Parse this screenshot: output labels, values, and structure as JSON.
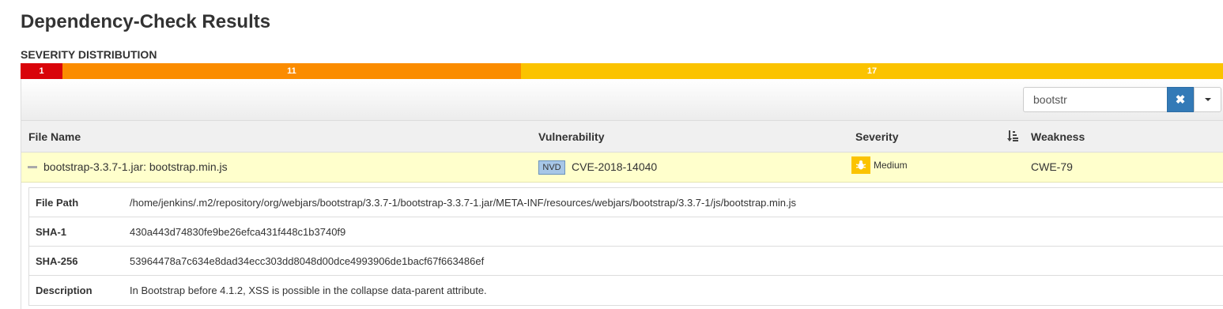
{
  "page": {
    "title": "Dependency-Check Results"
  },
  "severity_distribution": {
    "label": "SEVERITY DISTRIBUTION",
    "segments": [
      {
        "name": "critical",
        "count": "1",
        "color": "#d9040a"
      },
      {
        "name": "high",
        "count": "11",
        "color": "#fb8c00"
      },
      {
        "name": "medium",
        "count": "17",
        "color": "#fbc300"
      }
    ]
  },
  "search": {
    "value": "bootstr",
    "clear_icon": "times-icon",
    "dropdown_icon": "caret-down-icon"
  },
  "table": {
    "headers": {
      "file_name": "File Name",
      "vulnerability": "Vulnerability",
      "severity": "Severity",
      "weakness": "Weakness"
    },
    "sort_icon": "sort-amount-icon",
    "rows": [
      {
        "file_name": "bootstrap-3.3.7-1.jar: bootstrap.min.js",
        "source": "NVD",
        "vulnerability": "CVE-2018-14040",
        "severity": "Medium",
        "severity_icon": "bug-icon",
        "weakness": "CWE-79"
      }
    ]
  },
  "details": {
    "file_path_label": "File Path",
    "file_path": "/home/jenkins/.m2/repository/org/webjars/bootstrap/3.3.7-1/bootstrap-3.3.7-1.jar/META-INF/resources/webjars/bootstrap/3.3.7-1/js/bootstrap.min.js",
    "sha1_label": "SHA-1",
    "sha1": "430a443d74830fe9be26efca431f448c1b3740f9",
    "sha256_label": "SHA-256",
    "sha256": "53964478a7c634e8dad34ecc303dd8048d00dce4993906de1bacf67f663486ef",
    "description_label": "Description",
    "description": "In Bootstrap before 4.1.2, XSS is possible in the collapse data-parent attribute."
  }
}
